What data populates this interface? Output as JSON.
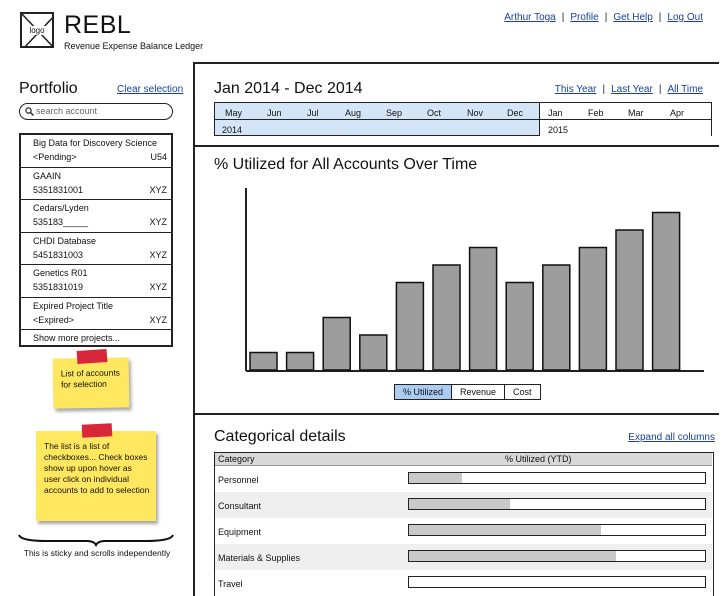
{
  "header": {
    "logo_text": "logo",
    "app_title": "REBL",
    "app_subtitle": "Revenue Expense Balance Ledger",
    "user_links": [
      "Arthur Toga",
      "Profile",
      "Get Help",
      "Log Out"
    ]
  },
  "sidebar": {
    "title": "Portfolio",
    "clear_link": "Clear selection",
    "search_placeholder": "search account",
    "accounts": [
      {
        "name": "Big Data for Discovery Science",
        "number": "<Pending>",
        "tag": "U54"
      },
      {
        "name": "GAAIN",
        "number": "5351831001",
        "tag": "XYZ"
      },
      {
        "name": "Cedars/Lyden",
        "number": "535183_____",
        "tag": "XYZ"
      },
      {
        "name": "CHDI Database",
        "number": "5451831003",
        "tag": "XYZ"
      },
      {
        "name": "Genetics R01",
        "number": "5351831019",
        "tag": "XYZ"
      },
      {
        "name": "Expired Project Title",
        "number": "<Expired>",
        "tag": "XYZ"
      }
    ],
    "show_more": "Show more projects...",
    "sticky_notes": [
      "List of accounts for selection",
      "The list is a list of checkboxes... Check boxes show up upon hover as user click on individual accounts to add to selection"
    ],
    "bottom_note": "This is sticky and scrolls independently"
  },
  "date_range": {
    "title": "Jan 2014 - Dec 2014",
    "links": [
      "This Year",
      "Last Year",
      "All Time"
    ],
    "selected_months": [
      "May",
      "Jun",
      "Jul",
      "Aug",
      "Sep",
      "Oct",
      "Nov",
      "Dec"
    ],
    "selected_year": "2014",
    "next_months": [
      "Jan",
      "Feb",
      "Mar",
      "Apr"
    ],
    "next_year": "2015"
  },
  "chart": {
    "title": "% Utilized for All Accounts Over Time",
    "tabs": [
      "% Utilized",
      "Revenue",
      "Cost"
    ],
    "active_tab": "% Utilized"
  },
  "chart_data": {
    "type": "bar",
    "title": "% Utilized for All Accounts Over Time",
    "categories": [
      "",
      "",
      "",
      "",
      "",
      "",
      "",
      "",
      "",
      "",
      "",
      ""
    ],
    "values": [
      10,
      10,
      30,
      20,
      50,
      60,
      70,
      50,
      60,
      70,
      80,
      90
    ],
    "ylim": [
      0,
      100
    ],
    "grid": false,
    "bar_color": "#9d9d9d"
  },
  "categorical": {
    "title": "Categorical details",
    "expand_link": "Expand all columns",
    "header_category": "Category",
    "header_utilized": "% Utilized (YTD)",
    "rows": [
      {
        "label": "Personnel",
        "utilized": 0.18
      },
      {
        "label": "Consultant",
        "utilized": 0.34
      },
      {
        "label": "Equipment",
        "utilized": 0.65
      },
      {
        "label": "Materials & Supplies",
        "utilized": 0.7
      },
      {
        "label": "Travel",
        "utilized": 0.0
      }
    ]
  }
}
